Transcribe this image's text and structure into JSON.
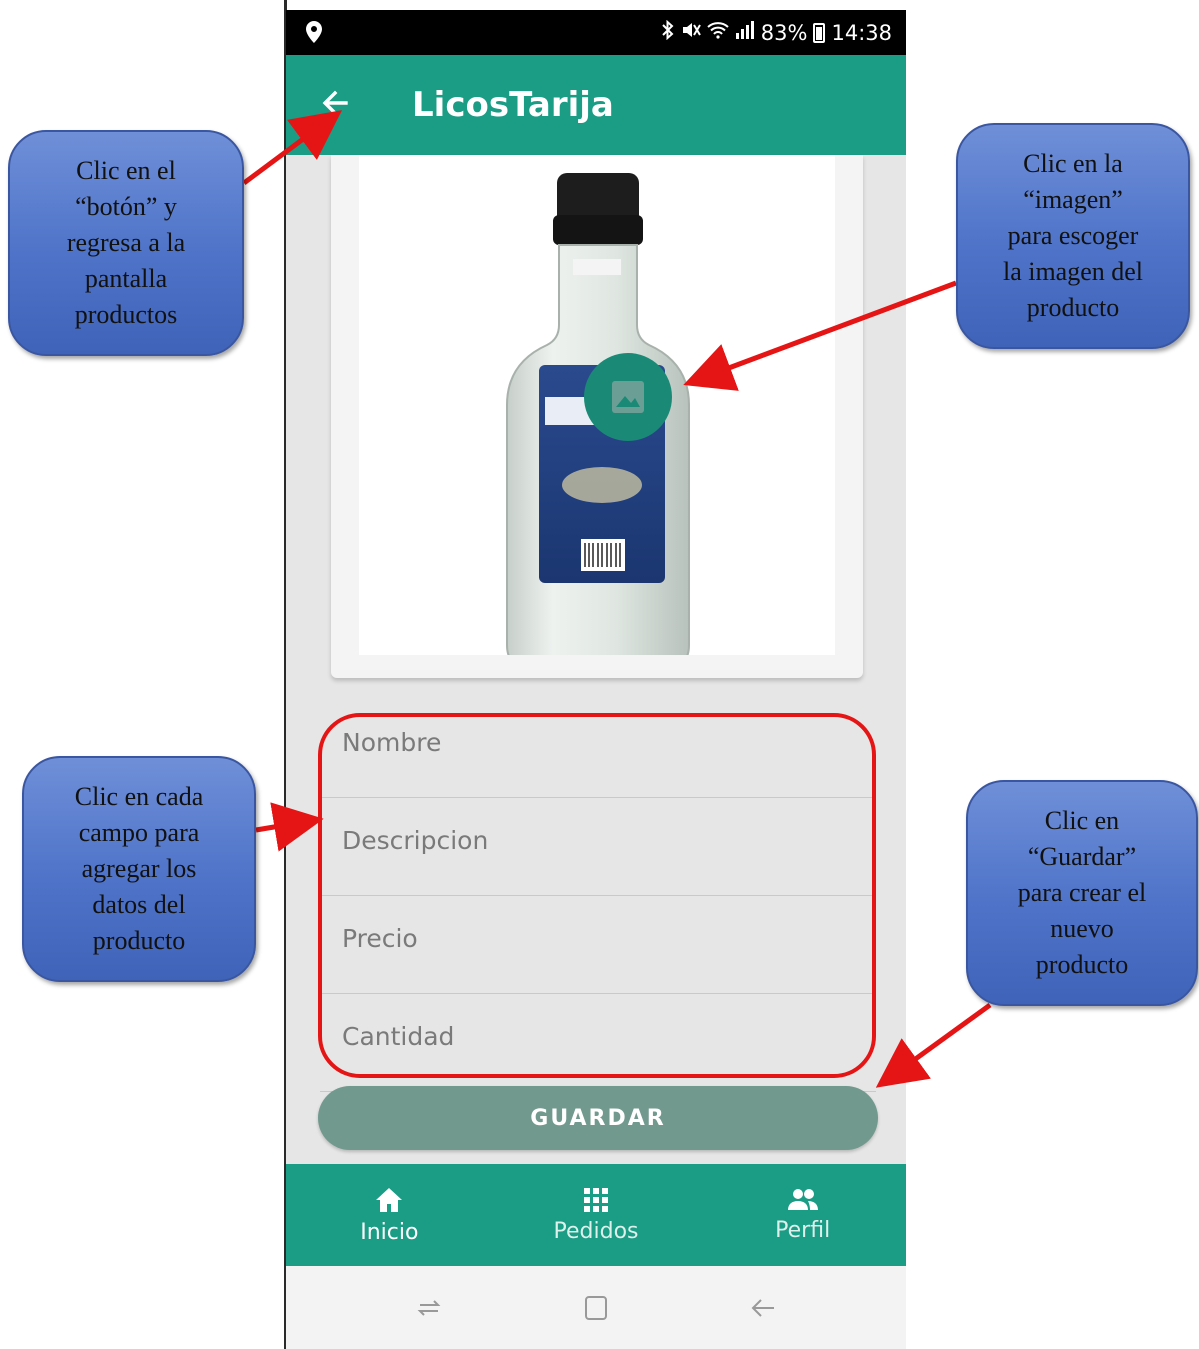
{
  "status_bar": {
    "battery": "83%",
    "time": "14:38"
  },
  "app_bar": {
    "title": "LicosTarija"
  },
  "form": {
    "fields": [
      {
        "placeholder": "Nombre"
      },
      {
        "placeholder": "Descripcion"
      },
      {
        "placeholder": "Precio"
      },
      {
        "placeholder": "Cantidad"
      }
    ],
    "save_label": "GUARDAR"
  },
  "bottom_nav": {
    "items": [
      {
        "label": "Inicio",
        "icon": "home-icon"
      },
      {
        "label": "Pedidos",
        "icon": "grid-icon"
      },
      {
        "label": "Perfil",
        "icon": "people-icon"
      }
    ]
  },
  "callouts": {
    "back": "Clic en el\n“botón” y\nregresa a la\npantalla\nproductos",
    "image": "Clic en la\n“imagen”\npara escoger\nla imagen del\nproducto",
    "fields": "Clic en cada\ncampo para\nagregar los\ndatos del\nproducto",
    "save": "Clic en\n“Guardar”\npara crear el\nnuevo\nproducto"
  },
  "colors": {
    "primary": "#1a9c85",
    "button": "#71998e",
    "annotation": "#e51515",
    "callout": "#4e73c8"
  }
}
